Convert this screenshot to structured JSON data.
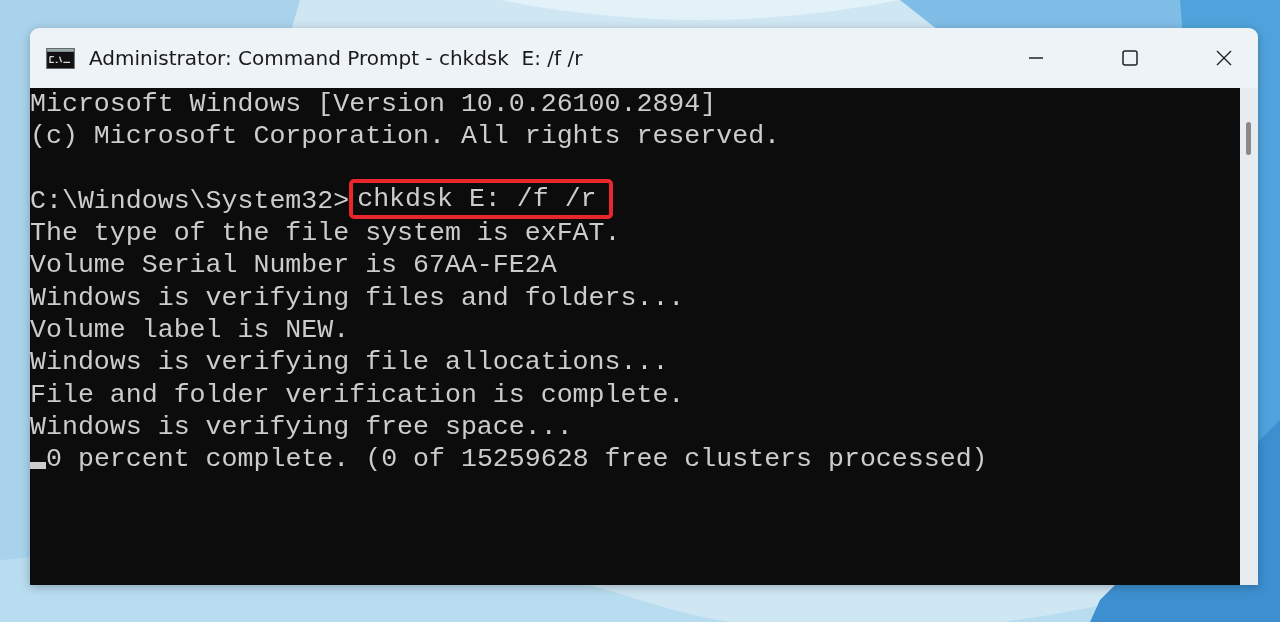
{
  "window": {
    "title": "Administrator: Command Prompt - chkdsk  E: /f /r"
  },
  "console": {
    "lines": [
      {
        "kind": "text",
        "text": "Microsoft Windows [Version 10.0.26100.2894]"
      },
      {
        "kind": "text",
        "text": "(c) Microsoft Corporation. All rights reserved."
      },
      {
        "kind": "blank"
      },
      {
        "kind": "prompt",
        "prompt": "C:\\Windows\\System32>",
        "command": "chkdsk E: /f /r",
        "highlighted": true
      },
      {
        "kind": "text",
        "text": "The type of the file system is exFAT."
      },
      {
        "kind": "text",
        "text": "Volume Serial Number is 67AA-FE2A"
      },
      {
        "kind": "text",
        "text": "Windows is verifying files and folders..."
      },
      {
        "kind": "text",
        "text": "Volume label is NEW."
      },
      {
        "kind": "text",
        "text": "Windows is verifying file allocations..."
      },
      {
        "kind": "text",
        "text": "File and folder verification is complete."
      },
      {
        "kind": "text",
        "text": "Windows is verifying free space..."
      },
      {
        "kind": "cursor",
        "text": "0 percent complete. (0 of 15259628 free clusters processed)"
      }
    ]
  }
}
